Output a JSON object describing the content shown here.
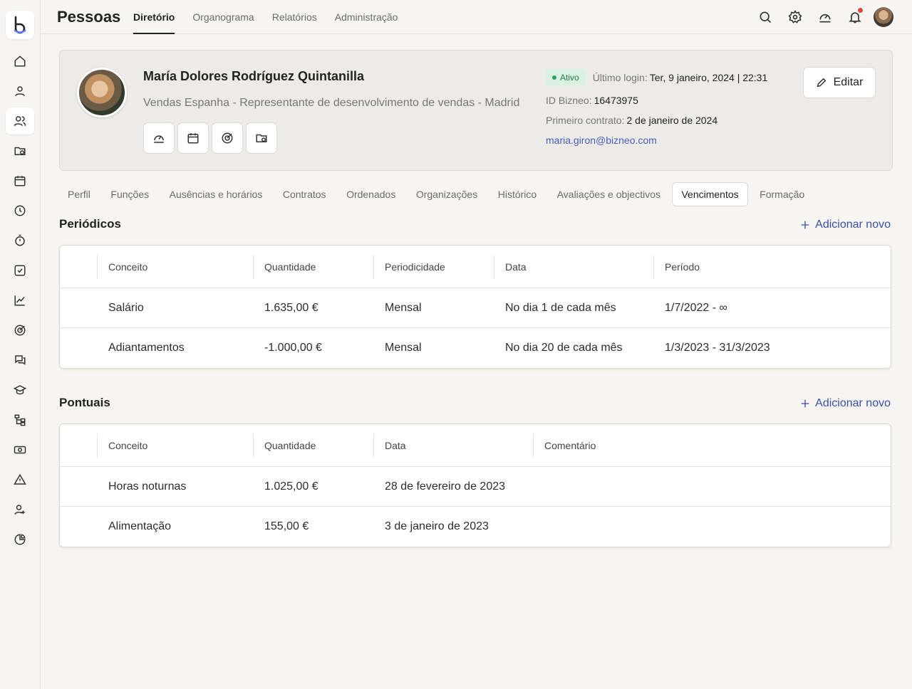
{
  "app": {
    "title": "Pessoas"
  },
  "topnav": [
    {
      "label": "Diretório",
      "active": true
    },
    {
      "label": "Organograma",
      "active": false
    },
    {
      "label": "Relatórios",
      "active": false
    },
    {
      "label": "Administração",
      "active": false
    }
  ],
  "top_icons": [
    "search-icon",
    "gear-icon",
    "speed-icon",
    "bell-icon",
    "user-avatar"
  ],
  "sidebar_icons": [
    "home-icon",
    "user-icon",
    "users-icon",
    "folder-icon",
    "calendar-icon",
    "clock-icon",
    "timer-icon",
    "check-square-icon",
    "chart-icon",
    "target-icon",
    "chat-icon",
    "graduation-cap-icon",
    "org-chart-icon",
    "money-icon",
    "alert-icon",
    "user-plus-icon",
    "pie-chart-icon"
  ],
  "profile": {
    "name": "María Dolores Rodríguez Quintanilla",
    "role": "Vendas Espanha - Representante de desenvolvimento de vendas - Madrid",
    "status": "Ativo",
    "last_login_label": "Último login:",
    "last_login_value": "Ter, 9 janeiro, 2024 | 22:31",
    "id_label": "ID Bizneo:",
    "id_value": "16473975",
    "contract_label": "Primeiro contrato:",
    "contract_value": "2 de janeiro de 2024",
    "email": "maria.giron@bizneo.com",
    "edit_label": "Editar",
    "quick_actions": [
      "speed-icon",
      "calendar-icon",
      "target-icon",
      "folder-icon"
    ]
  },
  "tabs": [
    {
      "label": "Perfil",
      "active": false
    },
    {
      "label": "Funções",
      "active": false
    },
    {
      "label": "Ausências e horários",
      "active": false
    },
    {
      "label": "Contratos",
      "active": false
    },
    {
      "label": "Ordenados",
      "active": false
    },
    {
      "label": "Organizações",
      "active": false
    },
    {
      "label": "Histórico",
      "active": false
    },
    {
      "label": "Avaliações e objectivos",
      "active": false
    },
    {
      "label": "Vencimentos",
      "active": true
    },
    {
      "label": "Formação",
      "active": false
    }
  ],
  "periodicos": {
    "title": "Periódicos",
    "add_label": "Adicionar novo",
    "columns": [
      "Conceito",
      "Quantidade",
      "Periodicidade",
      "Data",
      "Período"
    ],
    "rows": [
      [
        "Salário",
        "1.635,00 €",
        "Mensal",
        "No dia 1 de cada mês",
        "1/7/2022 - ∞"
      ],
      [
        "Adiantamentos",
        "-1.000,00 €",
        "Mensal",
        "No dia 20 de cada mês",
        "1/3/2023 - 31/3/2023"
      ]
    ]
  },
  "pontuais": {
    "title": "Pontuais",
    "add_label": "Adicionar novo",
    "columns": [
      "Conceito",
      "Quantidade",
      "Data",
      "Comentário"
    ],
    "rows": [
      [
        "Horas noturnas",
        "1.025,00 €",
        "28 de fevereiro de 2023",
        ""
      ],
      [
        "Alimentação",
        "155,00 €",
        "3 de janeiro de 2023",
        ""
      ]
    ]
  }
}
